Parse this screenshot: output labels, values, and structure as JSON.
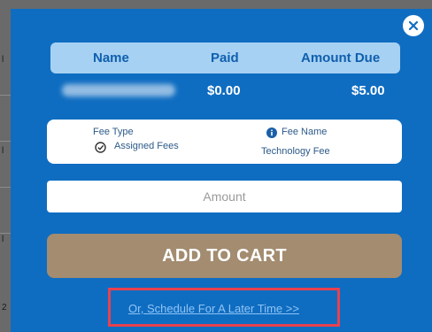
{
  "header": {
    "name_label": "Name",
    "paid_label": "Paid",
    "amount_due_label": "Amount Due"
  },
  "row": {
    "paid": "$0.00",
    "amount_due": "$5.00"
  },
  "fee": {
    "type_label": "Fee Type",
    "type_value": "Assigned Fees",
    "name_label": "Fee Name",
    "name_value": "Technology Fee"
  },
  "amount": {
    "placeholder": "Amount"
  },
  "cart_button": {
    "label": "ADD TO CART"
  },
  "schedule_link": {
    "label": "Or, Schedule For A Later Time >>"
  },
  "background_marks": [
    "l",
    "l",
    "l",
    "2"
  ],
  "icons": {
    "close": "close-icon",
    "fee_type": "check-circle-icon",
    "fee_name": "info-icon"
  },
  "colors": {
    "modal_bg": "#0f6dc1",
    "header_bg": "#a7d1f2",
    "cart_button_bg": "#a38c6f",
    "highlight_border": "#e8414f"
  }
}
